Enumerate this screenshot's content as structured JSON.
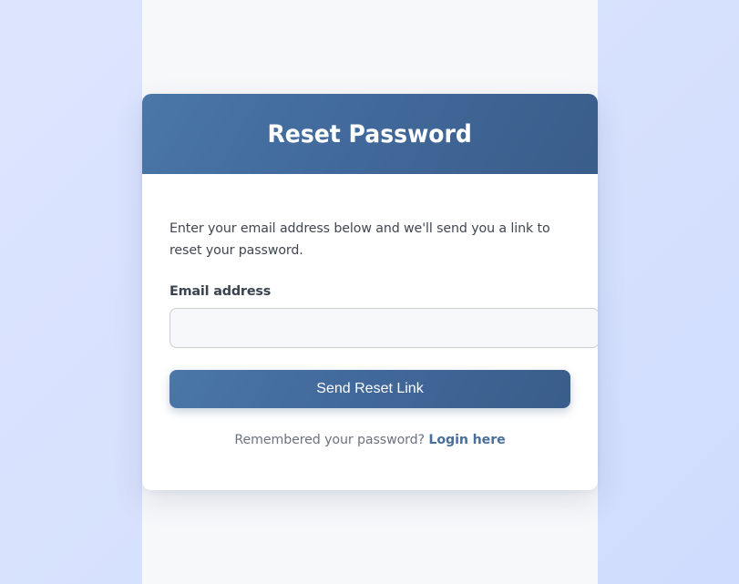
{
  "colors": {
    "page_background": "#dbe3fe",
    "column_background": "#f7f8fa",
    "header_gradient_start": "#4a76a8",
    "header_gradient_end": "#3a5d8a",
    "accent": "#4a6f9c",
    "text": "#3f4652",
    "muted_text": "#6b7280"
  },
  "card": {
    "title": "Reset Password",
    "intro": "Enter your email address below and we'll send you a link to reset your password."
  },
  "form": {
    "email_label": "Email address",
    "email_value": "",
    "email_placeholder": "",
    "submit_label": "Send Reset Link"
  },
  "footer": {
    "prompt": "Remembered your password?",
    "link_label": "Login here"
  }
}
